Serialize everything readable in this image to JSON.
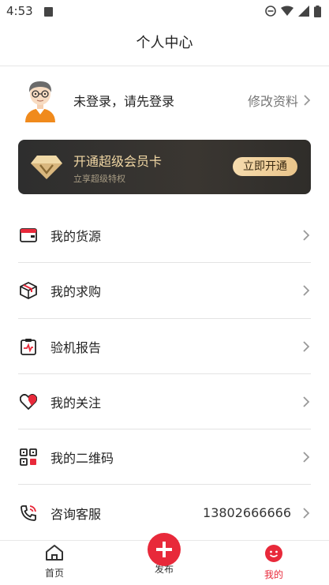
{
  "status_bar": {
    "time": "4:53"
  },
  "header": {
    "title": "个人中心"
  },
  "profile": {
    "login_prompt": "未登录，请先登录",
    "edit_label": "修改资料"
  },
  "vip": {
    "title": "开通超级会员卡",
    "subtitle": "立享超级特权",
    "button": "立即开通"
  },
  "menu": {
    "items": [
      {
        "label": "我的货源"
      },
      {
        "label": "我的求购"
      },
      {
        "label": "验机报告"
      },
      {
        "label": "我的关注"
      },
      {
        "label": "我的二维码"
      },
      {
        "label": "咨询客服",
        "value": "13802666666"
      }
    ]
  },
  "tabs": [
    {
      "label": "首页"
    },
    {
      "label": "发布"
    },
    {
      "label": "我的"
    }
  ],
  "colors": {
    "accent": "#e8293a",
    "gold": "#f1d7a4"
  }
}
